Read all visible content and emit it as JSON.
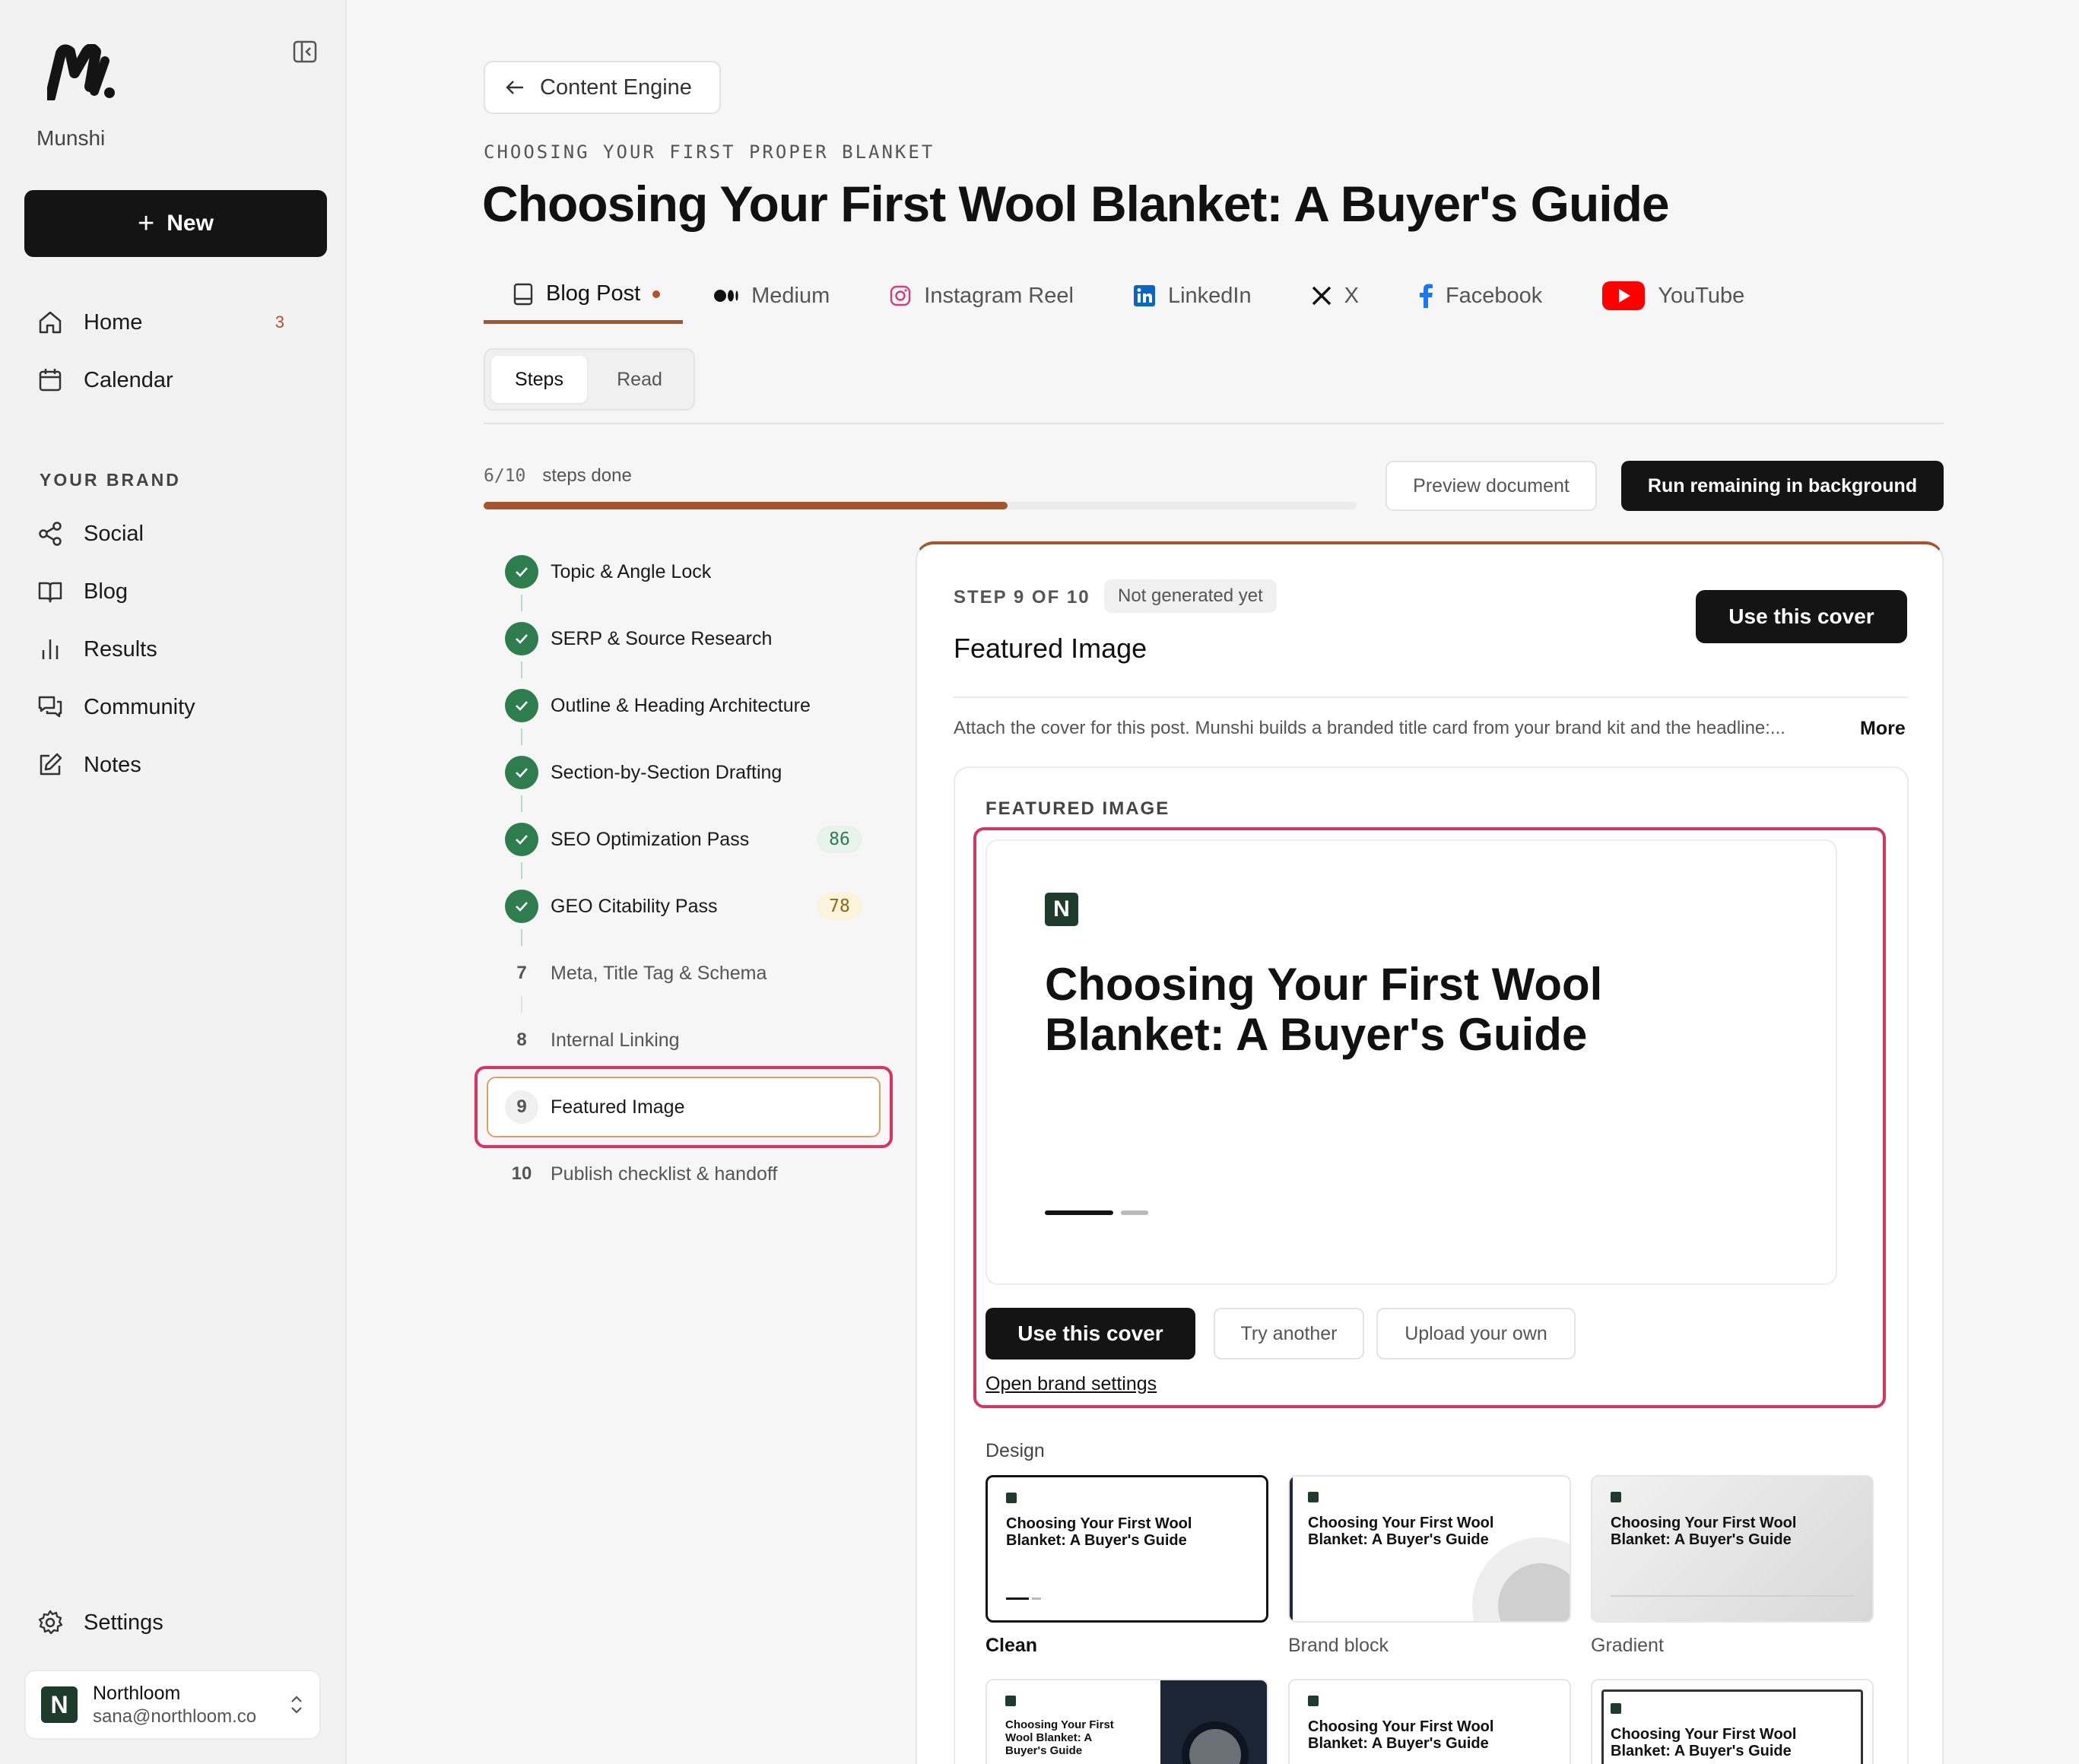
{
  "sidebar": {
    "brand_name": "Munshi",
    "new_label": "New",
    "nav": [
      {
        "label": "Home",
        "icon": "home-icon",
        "badge": "3"
      },
      {
        "label": "Calendar",
        "icon": "calendar-icon"
      }
    ],
    "brand_section_label": "YOUR BRAND",
    "brand_nav": [
      {
        "label": "Social",
        "icon": "share-icon"
      },
      {
        "label": "Blog",
        "icon": "book-icon"
      },
      {
        "label": "Results",
        "icon": "bar-chart-icon"
      },
      {
        "label": "Community",
        "icon": "chat-icon"
      },
      {
        "label": "Notes",
        "icon": "edit-icon"
      }
    ],
    "settings_label": "Settings",
    "account": {
      "avatar": "N",
      "name": "Northloom",
      "email": "sana@northloom.co"
    }
  },
  "header": {
    "back_label": "Content Engine",
    "eyebrow": "CHOOSING YOUR FIRST PROPER BLANKET",
    "title": "Choosing Your First Wool Blanket: A Buyer's Guide"
  },
  "channels": [
    {
      "label": "Blog Post",
      "icon": "blog-post-icon",
      "active": true
    },
    {
      "label": "Medium",
      "icon": "medium-icon"
    },
    {
      "label": "Instagram Reel",
      "icon": "instagram-icon"
    },
    {
      "label": "LinkedIn",
      "icon": "linkedin-icon"
    },
    {
      "label": "X",
      "icon": "x-icon"
    },
    {
      "label": "Facebook",
      "icon": "facebook-icon"
    },
    {
      "label": "YouTube",
      "icon": "youtube-icon"
    }
  ],
  "view_toggle": {
    "steps": "Steps",
    "read": "Read",
    "selected": "Steps"
  },
  "progress": {
    "done": "6/10",
    "label": "steps done",
    "fraction": 0.6
  },
  "actions": {
    "preview": "Preview document",
    "run": "Run remaining in background"
  },
  "steps": [
    {
      "n": "1",
      "label": "Topic & Angle Lock",
      "done": true
    },
    {
      "n": "2",
      "label": "SERP & Source Research",
      "done": true
    },
    {
      "n": "3",
      "label": "Outline & Heading Architecture",
      "done": true
    },
    {
      "n": "4",
      "label": "Section-by-Section Drafting",
      "done": true
    },
    {
      "n": "5",
      "label": "SEO Optimization Pass",
      "done": true,
      "score": "86",
      "score_tone": "green"
    },
    {
      "n": "6",
      "label": "GEO Citability Pass",
      "done": true,
      "score": "78",
      "score_tone": "yellow"
    },
    {
      "n": "7",
      "label": "Meta, Title Tag & Schema",
      "done": false
    },
    {
      "n": "8",
      "label": "Internal Linking",
      "done": false
    },
    {
      "n": "9",
      "label": "Featured Image",
      "done": false,
      "current": true
    },
    {
      "n": "10",
      "label": "Publish checklist & handoff",
      "done": false
    }
  ],
  "card": {
    "step_of": "STEP 9 OF 10",
    "status": "Not generated yet",
    "title": "Featured Image",
    "use_cover": "Use this cover",
    "description": "Attach the cover for this post. Munshi builds a branded title card from your brand kit and the headline:...",
    "more": "More",
    "section_label": "FEATURED IMAGE",
    "preview": {
      "logo": "N",
      "title": "Choosing Your First Wool Blanket: A Buyer's Guide"
    },
    "buttons": {
      "use": "Use this cover",
      "try": "Try another",
      "upload": "Upload your own"
    },
    "brand_link": "Open brand settings",
    "design_label": "Design",
    "designs": [
      {
        "name": "Clean",
        "title": "Choosing Your First Wool Blanket: A Buyer's Guide",
        "selected": true
      },
      {
        "name": "Brand block",
        "title": "Choosing Your First Wool Blanket: A Buyer's Guide"
      },
      {
        "name": "Gradient",
        "title": "Choosing Your First Wool Blanket: A Buyer's Guide"
      },
      {
        "name": "",
        "title": "Choosing Your First Wool Blanket: A Buyer's Guide"
      },
      {
        "name": "",
        "title": "Choosing Your First Wool Blanket: A Buyer's Guide"
      },
      {
        "name": "",
        "title": "Choosing Your First Wool Blanket: A Buyer's Guide"
      }
    ]
  },
  "colors": {
    "accent": "#a4552b",
    "success": "#2e7d4f",
    "highlight": "#d6365e",
    "dark": "#141414"
  }
}
